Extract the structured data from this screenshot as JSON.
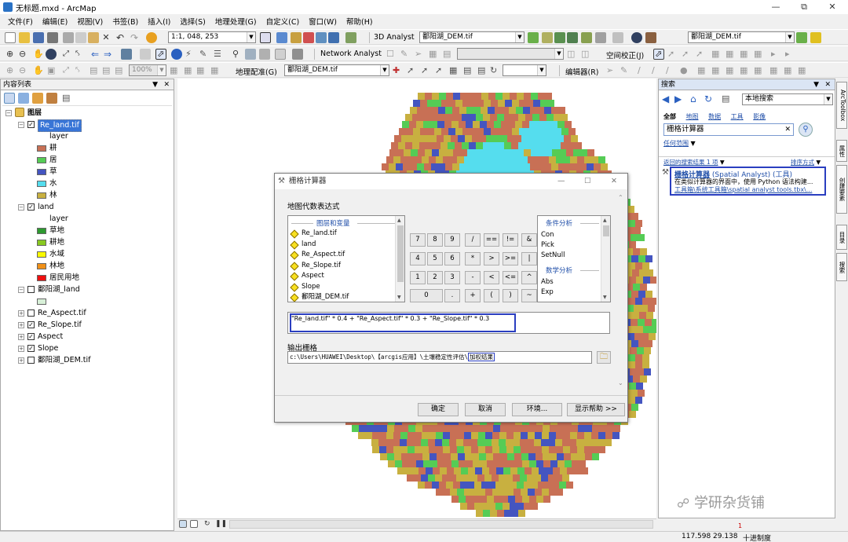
{
  "window": {
    "title": "无标题.mxd - ArcMap"
  },
  "menus": [
    "文件(F)",
    "编辑(E)",
    "视图(V)",
    "书签(B)",
    "插入(I)",
    "选择(S)",
    "地理处理(G)",
    "自定义(C)",
    "窗口(W)",
    "帮助(H)"
  ],
  "toolbar1": {
    "scale": "1:1, 048, 253",
    "analyst": "3D Analyst",
    "layer_combo": "鄱阳湖_DEM.tif",
    "layer_combo2": "鄱阳湖_DEM.tif"
  },
  "toolbar2": {
    "zoom": "100%",
    "network": "Network Analyst",
    "spatial_adjust": "空间校正(J)"
  },
  "toolbar3": {
    "georef": "地理配准(G)",
    "georef_layer": "鄱阳湖_DEM.tif",
    "editor": "编辑器(R)"
  },
  "toc": {
    "title": "内容列表",
    "root": "图层",
    "items": [
      {
        "label": "Re_land.tif",
        "checked": true,
        "expanded": true,
        "selected": true
      },
      {
        "label": "layer"
      },
      {
        "label": "耕",
        "color": "#c87055"
      },
      {
        "label": "居",
        "color": "#55cc55"
      },
      {
        "label": "草",
        "color": "#4455c0"
      },
      {
        "label": "水",
        "color": "#55ddee"
      },
      {
        "label": "林",
        "color": "#c8b040"
      },
      {
        "label": "land",
        "checked": true,
        "expanded": true
      },
      {
        "label": "layer"
      },
      {
        "label": "草地",
        "color": "#2e9a30"
      },
      {
        "label": "耕地",
        "color": "#88c820"
      },
      {
        "label": "水域",
        "color": "#f8f800"
      },
      {
        "label": "林地",
        "color": "#f09018"
      },
      {
        "label": "居民用地",
        "color": "#ee1010"
      },
      {
        "label": "鄱阳湖_land",
        "checked": false,
        "expanded": true
      },
      {
        "label": "",
        "color": "#d8f0d8"
      },
      {
        "label": "Re_Aspect.tif",
        "checked": false,
        "expanded": false
      },
      {
        "label": "Re_Slope.tif",
        "checked": true,
        "expanded": false
      },
      {
        "label": "Aspect",
        "checked": true,
        "expanded": false
      },
      {
        "label": "Slope",
        "checked": true,
        "expanded": false
      },
      {
        "label": "鄱阳湖_DEM.tif",
        "checked": false,
        "expanded": false
      }
    ]
  },
  "search": {
    "title": "搜索",
    "scope": "本地搜索",
    "tabs": [
      "全部",
      "地图",
      "数据",
      "工具",
      "影像"
    ],
    "query": "栅格计算器",
    "nearby": "任何范围",
    "results_label": "返回的搜索结果 1 项",
    "sort_label": "排序方式",
    "result_title": "栅格计算器",
    "result_sub": "(Spatial Analyst) (工具)",
    "result_desc": "在类似计算器的界面中，使用 Python 语法构建...",
    "result_path": "工具箱\\系统工具箱\\spatial analyst tools.tbx\\..."
  },
  "right_tabs": [
    "ArcToolbox",
    "属性",
    "创建要素",
    "目录",
    "搜索"
  ],
  "dialog": {
    "title": "栅格计算器",
    "expr_label": "地图代数表达式",
    "layers_header": "图层和变量",
    "layers": [
      "Re_land.tif",
      "land",
      "Re_Aspect.tif",
      "Re_Slope.tif",
      "Aspect",
      "Slope",
      "鄱阳湖_DEM.tif"
    ],
    "keypad": [
      [
        "7",
        "8",
        "9",
        "/",
        "==",
        "!=",
        "&"
      ],
      [
        "4",
        "5",
        "6",
        "*",
        ">",
        ">=",
        "|"
      ],
      [
        "1",
        "2",
        "3",
        "-",
        "<",
        "<=",
        "^"
      ],
      [
        "0",
        ".",
        "+",
        "(",
        ")",
        "~"
      ]
    ],
    "cond_header": "条件分析",
    "cond_items": [
      "Con",
      "Pick",
      "SetNull"
    ],
    "math_header": "数学分析",
    "math_items": [
      "Abs",
      "Exp"
    ],
    "expression": "\"Re_land.tif\" * 0.4 + \"Re_Aspect.tif\" * 0.3 + \"Re_Slope.tif\" * 0.3",
    "output_label": "输出栅格",
    "output_path_prefix": "c:\\Users\\HUAWEI\\Desktop\\【arcgis应用】\\土壤稳定性评估\\",
    "output_path_suffix": "加权结果",
    "buttons": {
      "ok": "确定",
      "cancel": "取消",
      "env": "环境...",
      "help": "显示帮助 >>"
    }
  },
  "status": {
    "page": "1",
    "x": "117.598",
    "y": "29.138",
    "units": "十进制度"
  },
  "watermark": "学研杂货铺",
  "map_colors": {
    "farm": "#c87055",
    "forest": "#c8b040",
    "grass": "#4455c0",
    "water": "#55ddee",
    "resident": "#55cc55"
  }
}
